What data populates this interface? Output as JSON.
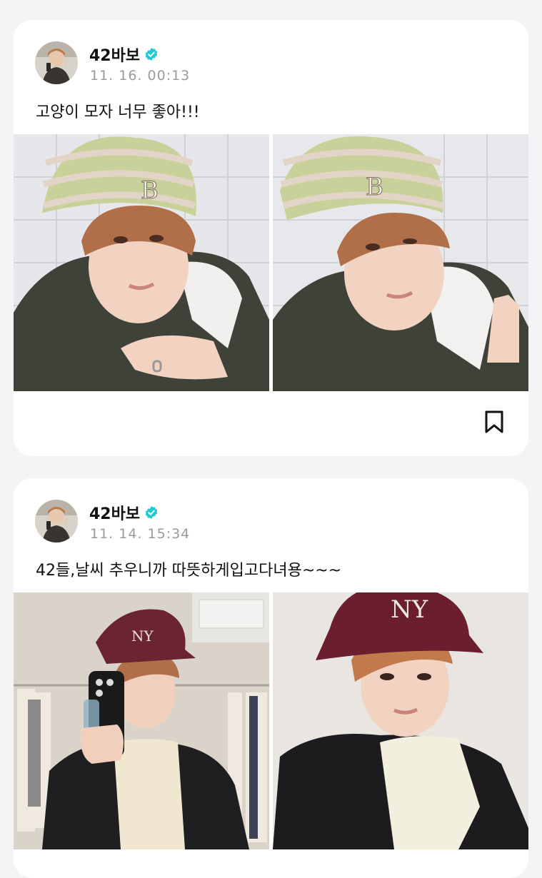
{
  "posts": [
    {
      "author": "42바보",
      "verified": true,
      "time": "11. 16. 00:13",
      "text": "고양이 모자 너무 좋아!!!",
      "photos": [
        "selfie-beanie-left",
        "selfie-beanie-right"
      ]
    },
    {
      "author": "42바보",
      "verified": true,
      "time": "11. 14. 15:34",
      "text": "42들,날씨 추우니까 따뜻하게입고다녀용~~~",
      "photos": [
        "mirror-selfie-cap",
        "selfie-cap"
      ]
    }
  ],
  "icons": {
    "verified": "verified-badge-icon",
    "bookmark": "bookmark-icon"
  },
  "colors": {
    "badge": "#1ec9d4",
    "background": "#f4f4f6",
    "time": "#9a9a9f"
  }
}
